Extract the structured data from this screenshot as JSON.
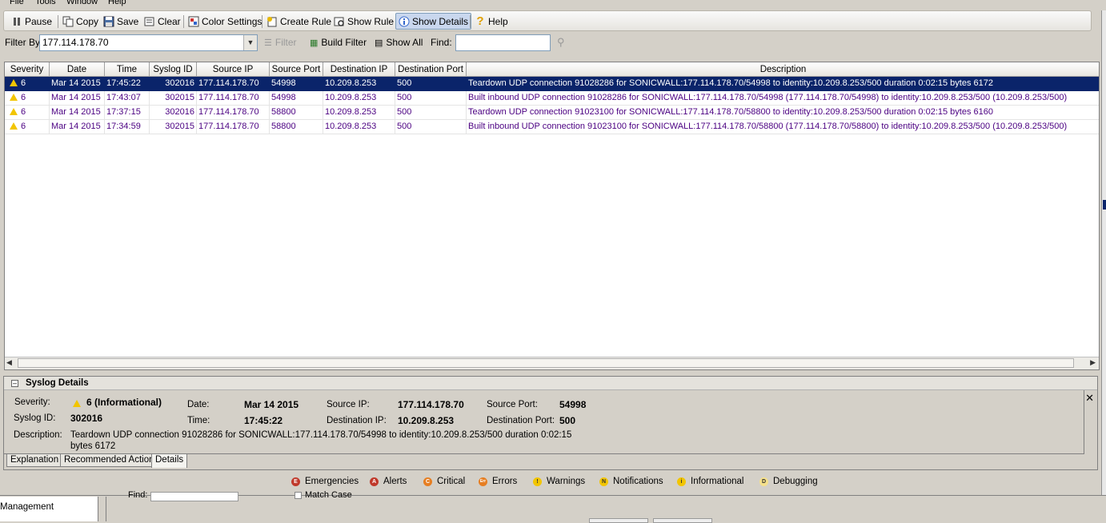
{
  "menu": [
    "File",
    "Tools",
    "Window",
    "Help"
  ],
  "toolbar": {
    "pause": "Pause",
    "copy": "Copy",
    "save": "Save",
    "clear": "Clear",
    "color_settings": "Color Settings",
    "create_rule": "Create Rule",
    "show_rule": "Show Rule",
    "show_details": "Show Details",
    "help": "Help"
  },
  "filterbar": {
    "filter_by_label": "Filter By:",
    "filter_value": "177.114.178.70",
    "filter_button": "Filter",
    "build_filter": "Build Filter",
    "show_all": "Show All",
    "find_label": "Find:",
    "find_value": ""
  },
  "table": {
    "columns": [
      "Severity",
      "Date",
      "Time",
      "Syslog ID",
      "Source IP",
      "Source Port",
      "Destination IP",
      "Destination Port",
      "Description"
    ],
    "rows": [
      [
        "6",
        "Mar 14 2015",
        "17:45:22",
        "302016",
        "177.114.178.70",
        "54998",
        "10.209.8.253",
        "500",
        "Teardown UDP connection 91028286 for SONICWALL:177.114.178.70/54998 to identity:10.209.8.253/500 duration 0:02:15 bytes 6172"
      ],
      [
        "6",
        "Mar 14 2015",
        "17:43:07",
        "302015",
        "177.114.178.70",
        "54998",
        "10.209.8.253",
        "500",
        "Built inbound UDP connection 91028286 for SONICWALL:177.114.178.70/54998 (177.114.178.70/54998) to identity:10.209.8.253/500 (10.209.8.253/500)"
      ],
      [
        "6",
        "Mar 14 2015",
        "17:37:15",
        "302016",
        "177.114.178.70",
        "58800",
        "10.209.8.253",
        "500",
        "Teardown UDP connection 91023100 for SONICWALL:177.114.178.70/58800 to identity:10.209.8.253/500 duration 0:02:15 bytes 6160"
      ],
      [
        "6",
        "Mar 14 2015",
        "17:34:59",
        "302015",
        "177.114.178.70",
        "58800",
        "10.209.8.253",
        "500",
        "Built inbound UDP connection 91023100 for SONICWALL:177.114.178.70/58800 (177.114.178.70/58800) to identity:10.209.8.253/500 (10.209.8.253/500)"
      ]
    ]
  },
  "details": {
    "title": "Syslog Details",
    "severity_label": "Severity:",
    "severity_value": "6 (Informational)",
    "syslog_id_label": "Syslog ID:",
    "syslog_id_value": "302016",
    "date_label": "Date:",
    "date_value": "Mar 14 2015",
    "time_label": "Time:",
    "time_value": "17:45:22",
    "source_ip_label": "Source IP:",
    "source_ip_value": "177.114.178.70",
    "destination_ip_label": "Destination IP:",
    "destination_ip_value": "10.209.8.253",
    "source_port_label": "Source Port:",
    "source_port_value": "54998",
    "destination_port_label": "Destination Port:",
    "destination_port_value": "500",
    "description_label": "Description:",
    "description_line1": "Teardown UDP connection 91028286 for SONICWALL:177.114.178.70/54998 to identity:10.209.8.253/500 duration 0:02:15",
    "description_line2": "bytes 6172"
  },
  "tabs": [
    "Explanation",
    "Recommended Action",
    "Details"
  ],
  "legend": [
    {
      "label": "Emergencies",
      "color": "#c0392b",
      "glyph": "E"
    },
    {
      "label": "Alerts",
      "color": "#c0392b",
      "glyph": "A"
    },
    {
      "label": "Critical",
      "color": "#e67e22",
      "glyph": "C"
    },
    {
      "label": "Errors",
      "color": "#e67e22",
      "glyph": "Err"
    },
    {
      "label": "Warnings",
      "color": "#f2c500",
      "glyph": "!"
    },
    {
      "label": "Notifications",
      "color": "#f2c500",
      "glyph": "N"
    },
    {
      "label": "Informational",
      "color": "#f2c500",
      "glyph": "i"
    },
    {
      "label": "Debugging",
      "color": "#f5e08a",
      "glyph": "D"
    }
  ],
  "background": {
    "management_label": "Management",
    "find_label": "Find:",
    "match_case": "Match Case"
  }
}
